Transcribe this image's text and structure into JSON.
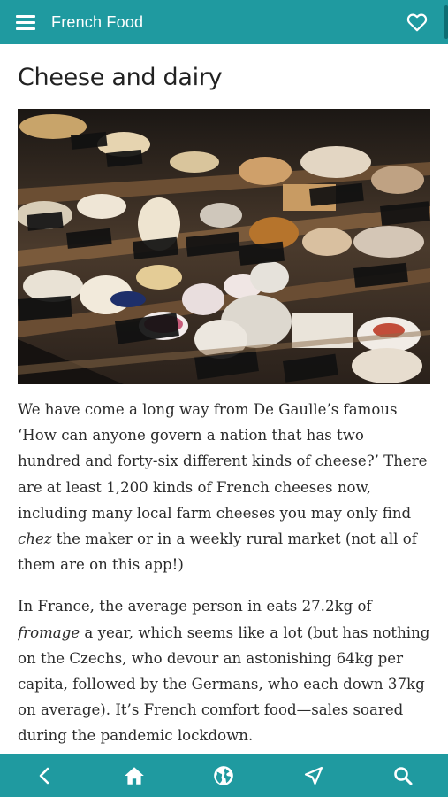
{
  "app": {
    "title": "French Food",
    "accent_color": "#1f9aa0"
  },
  "header": {
    "menu_icon": "menu-icon",
    "favorite_icon": "heart-icon"
  },
  "article": {
    "title": "Cheese and dairy",
    "image_alt": "cheese display counter",
    "paragraph1": {
      "before": "We have come a long way from De Gaulle’s famous ‘How can anyone govern a nation that has two hundred and forty-six different kinds of cheese?’ There are at least 1,200 kinds of French cheeses now, including many local farm cheeses you may only find ",
      "emph": "chez",
      "after": " the maker or in a weekly rural market (not all of them are on this app!)"
    },
    "paragraph2": {
      "before": "In France, the average person in eats 27.2kg of ",
      "emph": "fromage",
      "after": " a year, which seems like a lot (but has nothing on the Czechs, who devour an astonishing 64kg per capita, followed by the Germans, who each down 37kg on average). It’s French comfort food—sales soared during the pandemic lockdown."
    }
  },
  "bottom_nav": {
    "items": [
      {
        "icon": "back-icon"
      },
      {
        "icon": "home-icon"
      },
      {
        "icon": "globe-icon"
      },
      {
        "icon": "navigate-icon"
      },
      {
        "icon": "search-icon"
      }
    ]
  }
}
